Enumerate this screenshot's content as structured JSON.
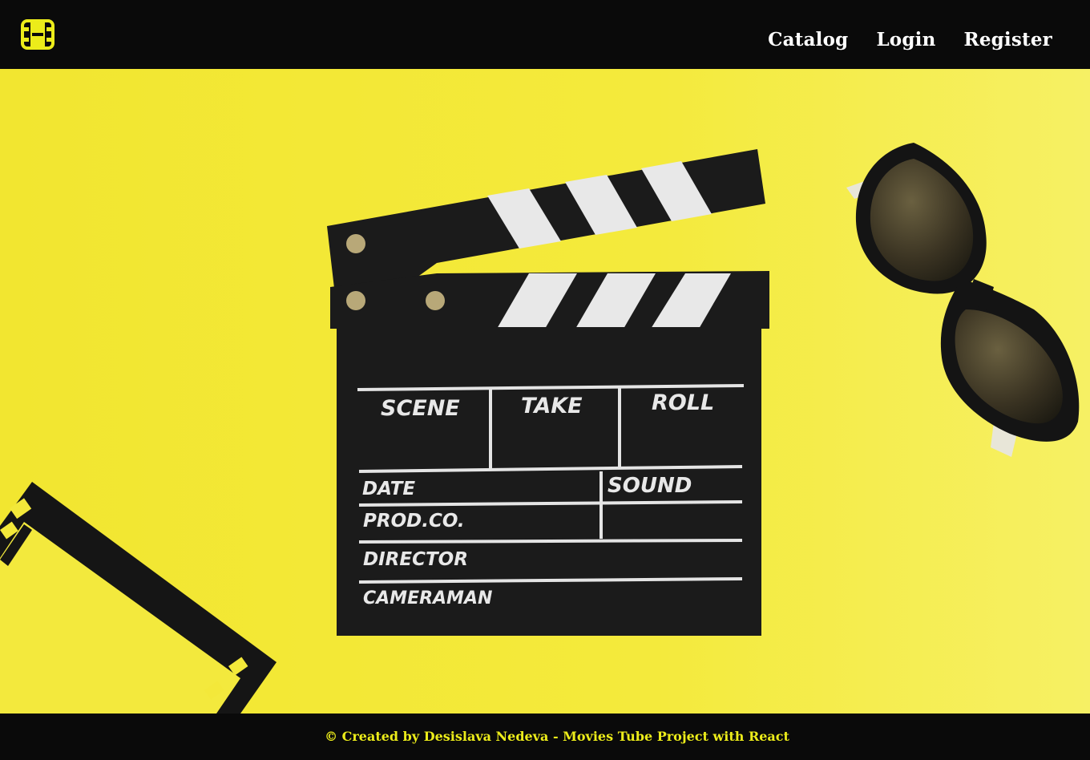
{
  "header": {
    "logo_icon": "film-icon",
    "nav": {
      "catalog": "Catalog",
      "login": "Login",
      "register": "Register"
    }
  },
  "hero": {
    "background_color": "#f3ea3a",
    "clapper_labels": {
      "scene": "SCENE",
      "take": "TAKE",
      "roll": "ROLL",
      "date": "DATE",
      "sound": "SOUND",
      "prod_co": "PROD.CO.",
      "director": "DIRECTOR",
      "cameraman": "CAMERAMAN"
    }
  },
  "footer": {
    "text": "© Created by Desislava Nedeva - Movies Tube Project with React"
  },
  "colors": {
    "accent": "#ecec1a",
    "bar": "#0a0a0a",
    "nav_text": "#ffffff"
  }
}
